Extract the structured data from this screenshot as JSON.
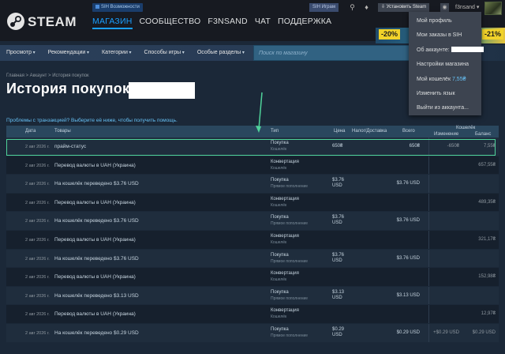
{
  "header": {
    "logo_text": "STEAM",
    "sih_link": "SIH Возможности",
    "nav": [
      "МАГАЗИН",
      "СООБЩЕСТВО",
      "F3NSAND",
      "ЧАТ",
      "ПОДДЕРЖКА"
    ],
    "sih_play": "SIH Играм",
    "install_button": "Установить Steam",
    "account_name": "f3nsand ▾"
  },
  "storebar": {
    "items": [
      "Просмотр",
      "Рекомендации",
      "Категории",
      "Способы игры",
      "Особые разделы"
    ],
    "search_placeholder": "Поиск по магазину"
  },
  "sale": {
    "badge_left": "-20%",
    "badge_right": "-21%"
  },
  "dropdown": {
    "profile": "Мой профиль",
    "sih_orders": "Мои заказы в SIH",
    "about_account": "Об аккаунте:",
    "store_settings": "Настройки магазина",
    "wallet_label": "Мой кошелёк",
    "wallet_value": "7,55₴",
    "change_language": "Изменить язык",
    "logout": "Выйти из аккаунта..."
  },
  "breadcrumb": "Главная > Аккаунт > История покупок",
  "page_title": "История покупок",
  "help_link": "Проблемы с транзакцией? Выберите её ниже, чтобы получить помощь.",
  "table": {
    "headers": {
      "date": "Дата",
      "items": "Товары",
      "type": "Тип",
      "price": "Цена",
      "tax": "Налог/Доставка",
      "total": "Всего",
      "wallet": "Кошелёк",
      "change": "Изменение",
      "balance": "Баланс"
    },
    "rows": [
      {
        "date": "2 авг 2026 г.",
        "item": "прайм-статус",
        "type": "Покупка",
        "sub": "Кошелёк",
        "price": "650₴",
        "total": "650₴",
        "change": "-650₴",
        "balance": "7,55₴"
      },
      {
        "date": "2 авг 2026 г.",
        "item": "Перевод валюты в UAH (Украина)",
        "type": "Конвертация",
        "sub": "Кошелёк",
        "price": "",
        "total": "",
        "change": "",
        "balance": "657,55₴"
      },
      {
        "date": "2 авг 2026 г.",
        "item": "На кошелёк переведено $3.76 USD",
        "type": "Покупка",
        "sub": "Прямое пополнение",
        "price": "$3.76 USD",
        "total": "$3.76 USD",
        "change": "",
        "balance": ""
      },
      {
        "date": "2 авг 2026 г.",
        "item": "Перевод валюты в UAH (Украина)",
        "type": "Конвертация",
        "sub": "Кошелёк",
        "price": "",
        "total": "",
        "change": "",
        "balance": "489,35₴"
      },
      {
        "date": "2 авг 2026 г.",
        "item": "На кошелёк переведено $3.76 USD",
        "type": "Покупка",
        "sub": "Прямое пополнение",
        "price": "$3.76 USD",
        "total": "$3.76 USD",
        "change": "",
        "balance": ""
      },
      {
        "date": "2 авг 2026 г.",
        "item": "Перевод валюты в UAH (Украина)",
        "type": "Конвертация",
        "sub": "Кошелёк",
        "price": "",
        "total": "",
        "change": "",
        "balance": "321,17₴"
      },
      {
        "date": "2 авг 2026 г.",
        "item": "На кошелёк переведено $3.76 USD",
        "type": "Покупка",
        "sub": "Прямое пополнение",
        "price": "$3.76 USD",
        "total": "$3.76 USD",
        "change": "",
        "balance": ""
      },
      {
        "date": "2 авг 2026 г.",
        "item": "Перевод валюты в UAH (Украина)",
        "type": "Конвертация",
        "sub": "Кошелёк",
        "price": "",
        "total": "",
        "change": "",
        "balance": "152,98₴"
      },
      {
        "date": "2 авг 2026 г.",
        "item": "На кошелёк переведено $3.13 USD",
        "type": "Покупка",
        "sub": "Прямое пополнение",
        "price": "$3.13 USD",
        "total": "$3.13 USD",
        "change": "",
        "balance": ""
      },
      {
        "date": "2 авг 2026 г.",
        "item": "Перевод валюты в UAH (Украина)",
        "type": "Конвертация",
        "sub": "Кошелёк",
        "price": "",
        "total": "",
        "change": "",
        "balance": "12,97₴"
      },
      {
        "date": "2 авг 2026 г.",
        "item": "На кошелёк переведено $0.29 USD",
        "type": "Покупка",
        "sub": "Прямое пополнение",
        "price": "$0.29 USD",
        "total": "$0.29 USD",
        "change": "+$0.29 USD",
        "balance": "$0.29 USD"
      }
    ]
  },
  "colors": {
    "accent": "#1a9fff",
    "highlight": "#4fd39a",
    "background": "#1b2838"
  }
}
